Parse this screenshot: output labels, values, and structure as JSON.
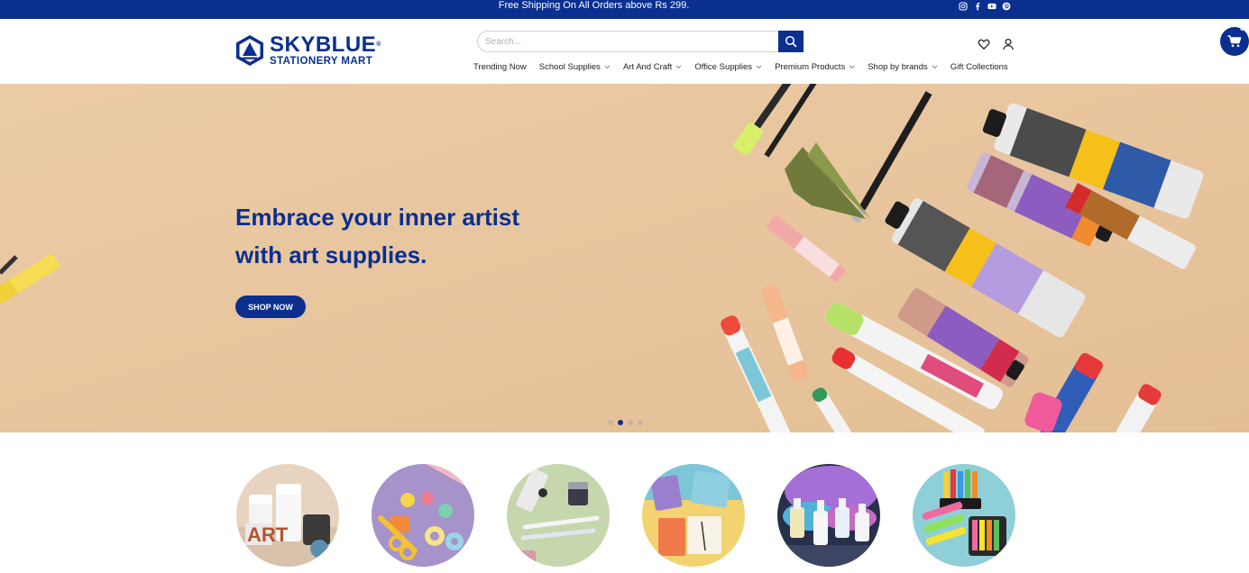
{
  "announcement": "Free Shipping On All Orders above Rs 299.",
  "social": [
    "instagram-icon",
    "facebook-icon",
    "youtube-icon",
    "pinterest-icon"
  ],
  "logo": {
    "title": "SKYBLUE",
    "subtitle": "STATIONERY MART",
    "trademark": "®"
  },
  "search": {
    "placeholder": "Search...",
    "value": ""
  },
  "nav": [
    {
      "label": "Trending Now",
      "dropdown": false
    },
    {
      "label": "School Supplies",
      "dropdown": true
    },
    {
      "label": "Art And Craft",
      "dropdown": true
    },
    {
      "label": "Office Supplies",
      "dropdown": true
    },
    {
      "label": "Premium Products",
      "dropdown": true
    },
    {
      "label": "Shop by brands",
      "dropdown": true
    },
    {
      "label": "Gift Collections",
      "dropdown": false
    }
  ],
  "header_icons": [
    "heart-icon",
    "user-icon"
  ],
  "cart": {
    "count": "0"
  },
  "hero": {
    "heading_line1": "Embrace your inner artist",
    "heading_line2": "with art supplies.",
    "button": "SHOP NOW",
    "slides": 4,
    "active_slide": 2
  },
  "categories": [
    {
      "name": "paint-jars"
    },
    {
      "name": "craft-tools"
    },
    {
      "name": "fountain-pens"
    },
    {
      "name": "notepads"
    },
    {
      "name": "ink-bottles"
    },
    {
      "name": "crayons"
    }
  ],
  "colors": {
    "brand": "#0a2f8f",
    "hero_bg": "#e9c7a0",
    "white": "#ffffff"
  }
}
